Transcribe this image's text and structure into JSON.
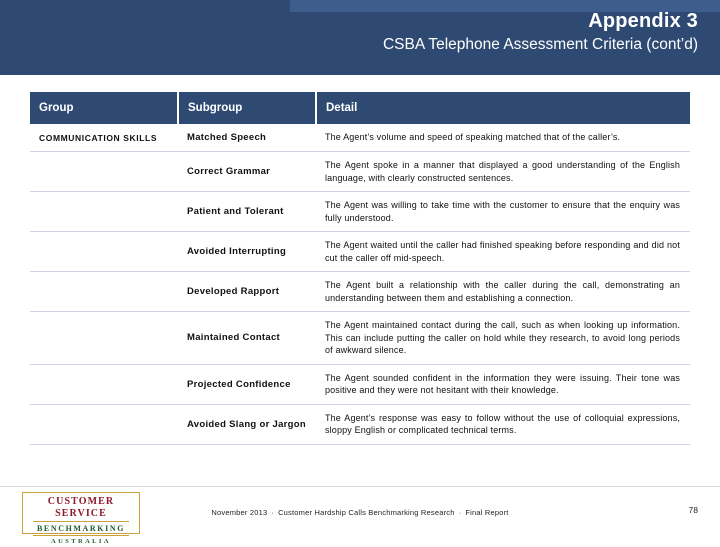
{
  "header": {
    "title": "Appendix 3",
    "subtitle": "CSBA Telephone Assessment Criteria (cont’d)",
    "bg_color": "#2e4a72",
    "accent_color": "#3d5e8c"
  },
  "table": {
    "columns": [
      "Group",
      "Subgroup",
      "Detail"
    ],
    "rows": [
      {
        "group": "COMMUNICATION SKILLS",
        "subgroup": "Matched Speech",
        "detail": "The Agent’s volume and speed of speaking matched that of the caller’s."
      },
      {
        "group": "",
        "subgroup": "Correct Grammar",
        "detail": "The Agent spoke in a manner that displayed a good understanding of the English language, with clearly constructed sentences."
      },
      {
        "group": "",
        "subgroup": "Patient and Tolerant",
        "detail": "The Agent was willing to take time with the customer to ensure that the enquiry was fully understood."
      },
      {
        "group": "",
        "subgroup": "Avoided Interrupting",
        "detail": "The Agent waited until the caller had finished speaking before responding and did not cut the caller off mid-speech."
      },
      {
        "group": "",
        "subgroup": "Developed Rapport",
        "detail": "The Agent built a relationship with the caller during the call, demonstrating an understanding between them and establishing a connection."
      },
      {
        "group": "",
        "subgroup": "Maintained Contact",
        "detail": "The Agent maintained contact during the call, such as when looking up information. This can include putting the caller on hold while they research, to avoid long periods of awkward silence."
      },
      {
        "group": "",
        "subgroup": "Projected Confidence",
        "detail": "The Agent sounded confident in the information they were issuing. Their tone was positive and they were not hesitant with their knowledge."
      },
      {
        "group": "",
        "subgroup": "Avoided Slang or Jargon",
        "detail": "The Agent’s response was easy to follow without the use of colloquial expressions, sloppy English or complicated technical terms."
      }
    ]
  },
  "footer": {
    "logo": {
      "line1": "CUSTOMER SERVICE",
      "line2": "BENCHMARKING",
      "line3": "AUSTRALIA"
    },
    "date": "November 2013",
    "separator1": "·",
    "report_name": "Customer Hardship Calls Benchmarking Research",
    "separator2": "·",
    "report_status": "Final Report",
    "page_number": "78"
  }
}
